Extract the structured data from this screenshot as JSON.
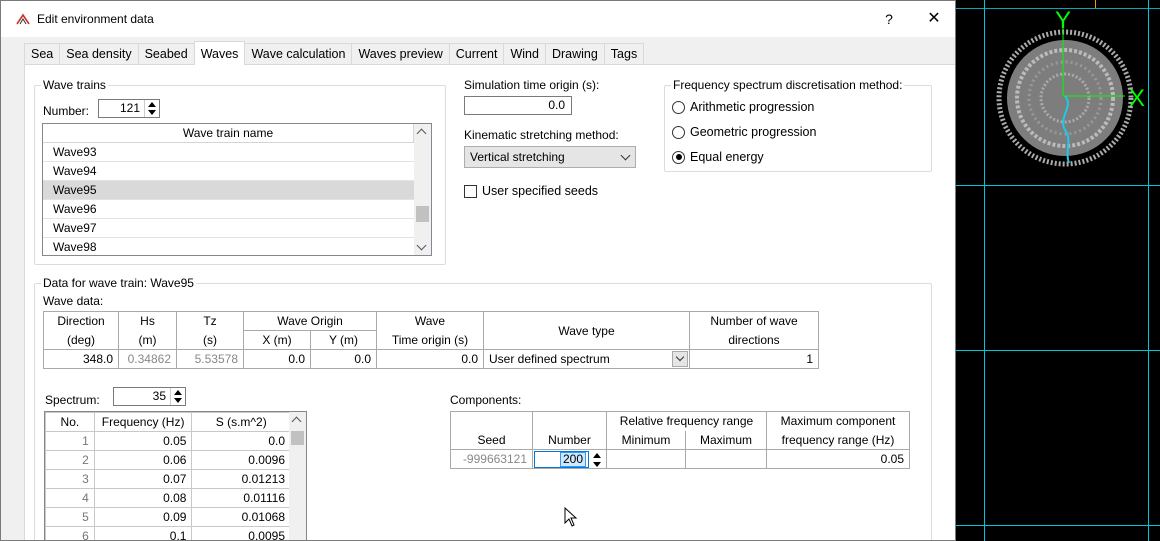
{
  "window": {
    "title": "Edit environment data",
    "help_label": "?",
    "close_label": "✕"
  },
  "tabs": [
    {
      "label": "Sea"
    },
    {
      "label": "Sea density"
    },
    {
      "label": "Seabed"
    },
    {
      "label": "Waves"
    },
    {
      "label": "Wave calculation"
    },
    {
      "label": "Waves preview"
    },
    {
      "label": "Current"
    },
    {
      "label": "Wind"
    },
    {
      "label": "Drawing"
    },
    {
      "label": "Tags"
    }
  ],
  "wave_trains": {
    "group_title": "Wave trains",
    "number_label": "Number:",
    "number_value": "121",
    "column_header": "Wave train name",
    "rows": [
      "Wave93",
      "Wave94",
      "Wave95",
      "Wave96",
      "Wave97",
      "Wave98"
    ],
    "selected": "Wave95"
  },
  "simulation": {
    "time_origin_label": "Simulation time origin (s):",
    "time_origin_value": "0.0",
    "stretching_label": "Kinematic stretching method:",
    "stretching_value": "Vertical stretching",
    "seeds_label": "User specified seeds"
  },
  "frequency": {
    "group_title": "Frequency spectrum discretisation method:",
    "options": [
      {
        "label": "Arithmetic progression",
        "selected": false
      },
      {
        "label": "Geometric progression",
        "selected": false
      },
      {
        "label": "Equal energy",
        "selected": true
      }
    ]
  },
  "wave_data": {
    "group_title": "Data for wave train: Wave95",
    "subtitle": "Wave data:",
    "headers": {
      "direction": "Direction",
      "direction_unit": "(deg)",
      "hs": "Hs",
      "hs_unit": "(m)",
      "tz": "Tz",
      "tz_unit": "(s)",
      "origin": "Wave Origin",
      "x": "X (m)",
      "y": "Y (m)",
      "time": "Wave",
      "time_unit": "Time origin (s)",
      "type": "Wave type",
      "ndir": "Number of wave",
      "ndir_unit": "directions"
    },
    "row": {
      "direction": "348.0",
      "hs": "0.34862",
      "tz": "5.53578",
      "x": "0.0",
      "y": "0.0",
      "time": "0.0",
      "type": "User defined spectrum",
      "ndir": "1"
    }
  },
  "spectrum": {
    "label": "Spectrum:",
    "count": "35",
    "headers": {
      "no": "No.",
      "freq": "Frequency (Hz)",
      "s": "S (s.m^2)"
    },
    "rows": [
      {
        "no": "1",
        "freq": "0.05",
        "s": "0.0"
      },
      {
        "no": "2",
        "freq": "0.06",
        "s": "0.0096"
      },
      {
        "no": "3",
        "freq": "0.07",
        "s": "0.01213"
      },
      {
        "no": "4",
        "freq": "0.08",
        "s": "0.01116"
      },
      {
        "no": "5",
        "freq": "0.09",
        "s": "0.01068"
      },
      {
        "no": "6",
        "freq": "0.1",
        "s": "0.0095"
      }
    ]
  },
  "components": {
    "label": "Components:",
    "headers": {
      "seed": "Seed",
      "number": "Number",
      "range": "Relative frequency range",
      "min": "Minimum",
      "max": "Maximum",
      "maxcomp": "Maximum component",
      "maxcomp_unit": "frequency range (Hz)"
    },
    "row": {
      "seed": "-999663121",
      "number": "200",
      "min": "",
      "max": "",
      "maxcomp": "0.05"
    }
  },
  "view3d": {
    "axis_y": "Y",
    "axis_x": "X"
  },
  "colors": {
    "accent_grid": "#00c8d8",
    "axis_green": "#00ff00",
    "orange": "#ff9900"
  }
}
